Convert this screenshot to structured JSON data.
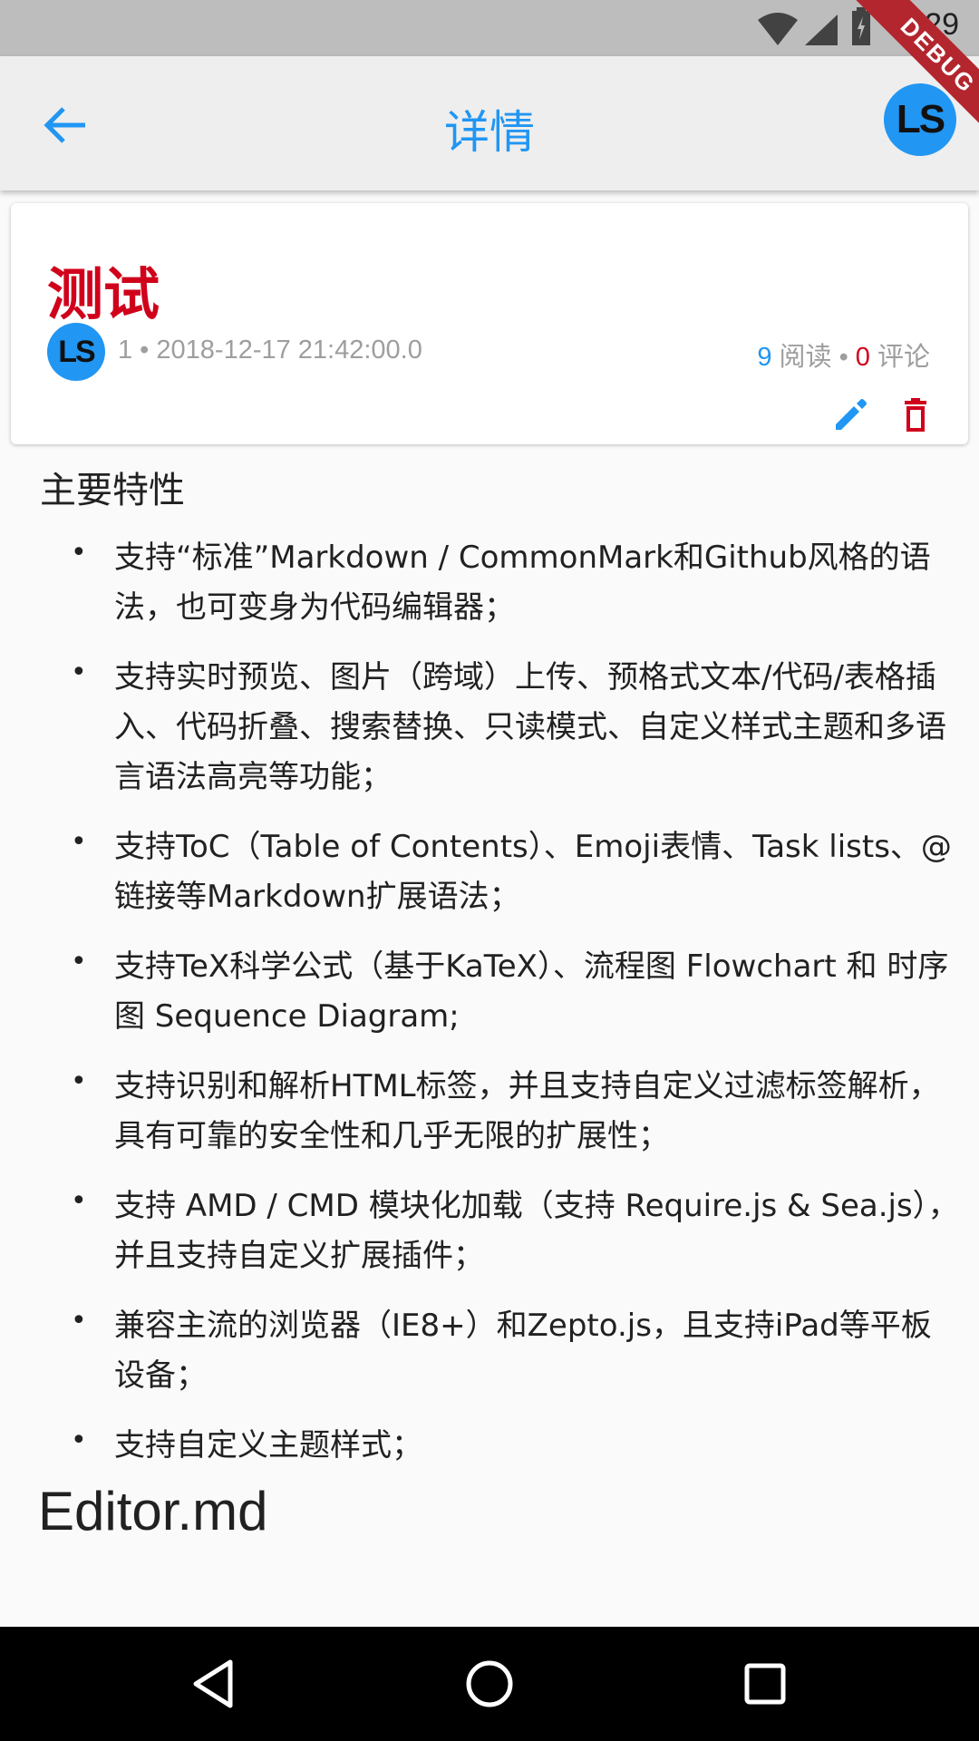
{
  "status_bar": {
    "time": "7:29"
  },
  "debug_banner": "DEBUG",
  "app_bar": {
    "title": "详情",
    "avatar_initials": "LS"
  },
  "post": {
    "title": "测试",
    "author_avatar_initials": "LS",
    "meta": "1 • 2018-12-17 21:42:00.0",
    "read_count": "9",
    "read_label": " 阅读 • ",
    "comment_count": "0",
    "comment_label": " 评论"
  },
  "content": {
    "heading": "主要特性",
    "features": [
      "支持“标准”Markdown / CommonMark和Github风格的语法，也可变身为代码编辑器；",
      "支持实时预览、图片（跨域）上传、预格式文本/代码/表格插入、代码折叠、搜索替换、只读模式、自定义样式主题和多语言语法高亮等功能；",
      "支持ToC（Table of Contents）、Emoji表情、Task lists、@链接等Markdown扩展语法；",
      "支持TeX科学公式（基于KaTeX）、流程图 Flowchart 和 时序图 Sequence Diagram;",
      "支持识别和解析HTML标签，并且支持自定义过滤标签解析，具有可靠的安全性和几乎无限的扩展性；",
      "支持 AMD / CMD 模块化加载（支持 Require.js & Sea.js），并且支持自定义扩展插件；",
      "兼容主流的浏览器（IE8+）和Zepto.js，且支持iPad等平板设备；",
      "支持自定义主题样式；"
    ],
    "subheading": "Editor.md"
  },
  "colors": {
    "accent": "#2196f3",
    "danger": "#d0021b"
  },
  "icons": {
    "back": "arrow-back-icon",
    "edit": "pencil-icon",
    "delete": "trash-icon",
    "nav_back": "triangle-back-icon",
    "nav_home": "circle-home-icon",
    "nav_recents": "square-recents-icon"
  }
}
